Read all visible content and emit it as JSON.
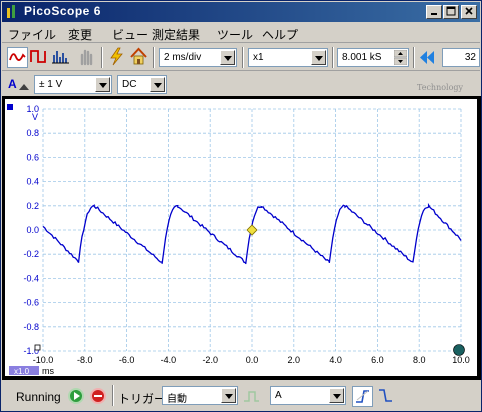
{
  "window": {
    "title": "PicoScope  6"
  },
  "menu": {
    "items": [
      "ファイル",
      "変更",
      "ビュー",
      "測定結果",
      "ツール",
      "ヘルプ"
    ]
  },
  "toolbar": {
    "timebase": "2 ms/div",
    "zoom": "x1",
    "samples": "8.001 kS",
    "page_count": "32"
  },
  "channel_bar": {
    "channel": "A",
    "range": "± 1 V",
    "coupling": "DC",
    "watermark": "Technology"
  },
  "scope": {
    "y_unit": "V",
    "x_unit": "ms",
    "zoom_badge": "x1.0",
    "y_ticks": [
      "1.0",
      "0.8",
      "0.6",
      "0.4",
      "0.2",
      "0.0",
      "-0.2",
      "-0.4",
      "-0.6",
      "-0.8",
      "-1.0"
    ],
    "x_ticks": [
      "-10.0",
      "-8.0",
      "-6.0",
      "-4.0",
      "-2.0",
      "0.0",
      "2.0",
      "4.0",
      "6.0",
      "8.0",
      "10.0"
    ],
    "trace_color": "#0000cc",
    "grid_color": "#9fc7e8",
    "trigger_marker_color": "#f0e040"
  },
  "chart_data": {
    "type": "line",
    "xlabel": "ms",
    "ylabel": "V",
    "xlim": [
      -10.0,
      10.0
    ],
    "ylim": [
      -1.0,
      1.0
    ],
    "series": [
      {
        "x": [
          -10.0,
          -8.3,
          -7.55,
          -4.3,
          -3.55,
          -0.3,
          0.45,
          3.7,
          4.45,
          7.7,
          8.45,
          10.0
        ],
        "y": [
          0.03,
          -0.26,
          0.2,
          -0.27,
          0.2,
          -0.27,
          0.2,
          -0.27,
          0.2,
          -0.27,
          0.2,
          -0.08
        ]
      }
    ]
  },
  "statusbar": {
    "status": "Running",
    "trigger_label": "トリガー",
    "trigger_mode": "自動",
    "trigger_source": "A"
  }
}
